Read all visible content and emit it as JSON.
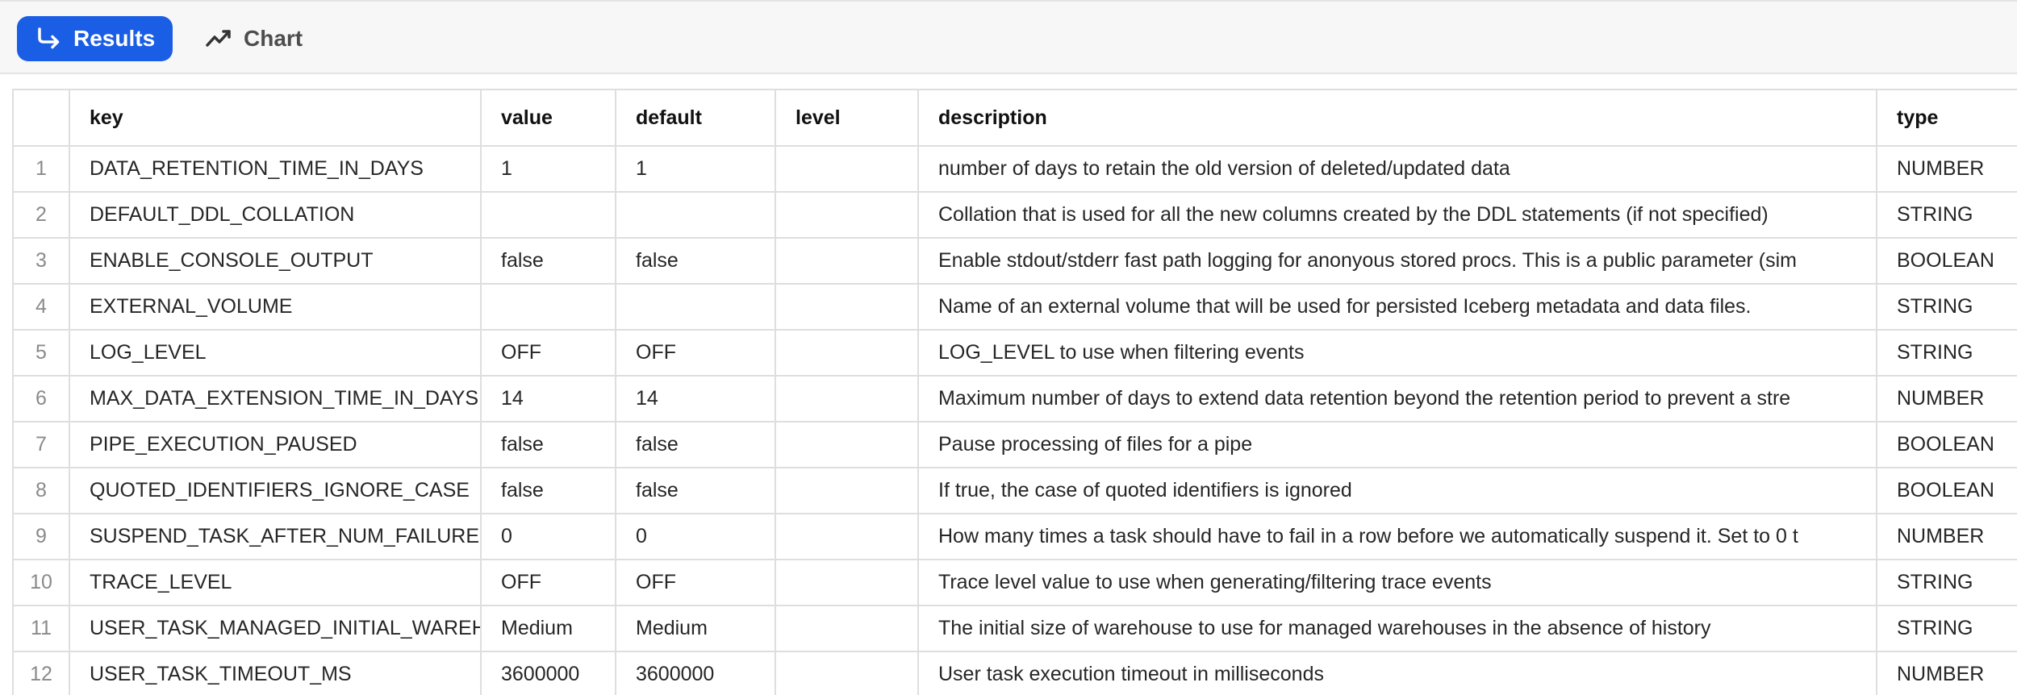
{
  "toolbar": {
    "results_label": "Results",
    "chart_label": "Chart",
    "results_icon": "arrow-turn-right-icon",
    "chart_icon": "line-chart-icon",
    "accent_color": "#1b5ee6"
  },
  "table": {
    "columns": [
      "",
      "key",
      "value",
      "default",
      "level",
      "description",
      "type"
    ],
    "rows": [
      {
        "num": "1",
        "key": "DATA_RETENTION_TIME_IN_DAYS",
        "value": "1",
        "default": "1",
        "level": "",
        "description": "number of days to retain the old version of deleted/updated data",
        "type": "NUMBER"
      },
      {
        "num": "2",
        "key": "DEFAULT_DDL_COLLATION",
        "value": "",
        "default": "",
        "level": "",
        "description": "Collation that is used for all the new columns created by the DDL statements (if not specified)",
        "type": "STRING"
      },
      {
        "num": "3",
        "key": "ENABLE_CONSOLE_OUTPUT",
        "value": "false",
        "default": "false",
        "level": "",
        "description": "Enable stdout/stderr fast path logging for anonyous stored procs. This is a public parameter (sim",
        "type": "BOOLEAN"
      },
      {
        "num": "4",
        "key": "EXTERNAL_VOLUME",
        "value": "",
        "default": "",
        "level": "",
        "description": "Name of an external volume that will be used for persisted Iceberg metadata and data files.",
        "type": "STRING"
      },
      {
        "num": "5",
        "key": "LOG_LEVEL",
        "value": "OFF",
        "default": "OFF",
        "level": "",
        "description": "LOG_LEVEL to use when filtering events",
        "type": "STRING"
      },
      {
        "num": "6",
        "key": "MAX_DATA_EXTENSION_TIME_IN_DAYS",
        "value": "14",
        "default": "14",
        "level": "",
        "description": "Maximum number of days to extend data retention beyond the retention period to prevent a stre",
        "type": "NUMBER"
      },
      {
        "num": "7",
        "key": "PIPE_EXECUTION_PAUSED",
        "value": "false",
        "default": "false",
        "level": "",
        "description": "Pause processing of files for a pipe",
        "type": "BOOLEAN"
      },
      {
        "num": "8",
        "key": "QUOTED_IDENTIFIERS_IGNORE_CASE",
        "value": "false",
        "default": "false",
        "level": "",
        "description": "If true, the case of quoted identifiers is ignored",
        "type": "BOOLEAN"
      },
      {
        "num": "9",
        "key": "SUSPEND_TASK_AFTER_NUM_FAILURES",
        "value": "0",
        "default": "0",
        "level": "",
        "description": "How many times a task should have to fail in a row before we automatically suspend it. Set to 0 t",
        "type": "NUMBER"
      },
      {
        "num": "10",
        "key": "TRACE_LEVEL",
        "value": "OFF",
        "default": "OFF",
        "level": "",
        "description": "Trace level value to use when generating/filtering trace events",
        "type": "STRING"
      },
      {
        "num": "11",
        "key": "USER_TASK_MANAGED_INITIAL_WAREHOUSE_SIZE",
        "value": "Medium",
        "default": "Medium",
        "level": "",
        "description": "The initial size of warehouse to use for managed warehouses in the absence of history",
        "type": "STRING"
      },
      {
        "num": "12",
        "key": "USER_TASK_TIMEOUT_MS",
        "value": "3600000",
        "default": "3600000",
        "level": "",
        "description": "User task execution timeout in milliseconds",
        "type": "NUMBER"
      }
    ]
  }
}
